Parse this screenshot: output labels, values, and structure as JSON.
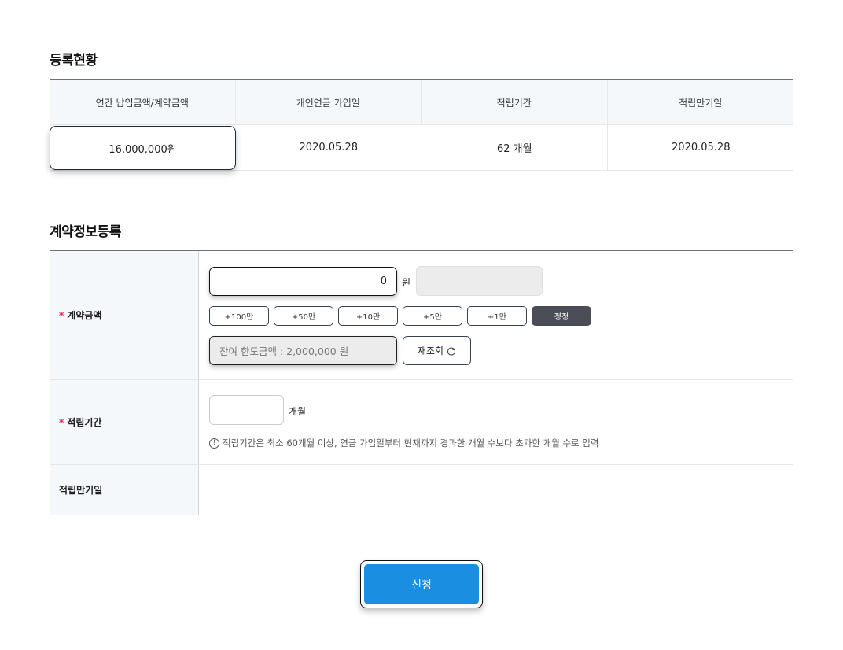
{
  "status": {
    "title": "등록현황",
    "headers": [
      "연간 납입금액/계약금액",
      "개인연금 가입일",
      "적립기간",
      "적립만기일"
    ],
    "values": [
      "16,000,000원",
      "2020.05.28",
      "62 개월",
      "2020.05.28"
    ]
  },
  "contract": {
    "title": "계약정보등록",
    "required_mark": "*",
    "amount_label": "계약금액",
    "amount_value": "0",
    "amount_unit": "원",
    "chips": [
      "+100만",
      "+50만",
      "+10만",
      "+5만",
      "+1만"
    ],
    "correct_label": "정정",
    "limit_text": "잔여 한도금액 : 2,000,000 원",
    "refresh_label": "재조회",
    "period_label": "적립기간",
    "period_value": "",
    "period_unit": "개월",
    "info_glyph": "!",
    "period_note": "적립기간은 최소 60개월 이상, 연금 가입일부터 현재까지 경과한 개월 수보다 초과한 개월 수로 입력",
    "maturity_label": "적립만기일"
  },
  "submit_label": "신청",
  "colors": {
    "accent": "#1a8ee0",
    "required": "#e11d48",
    "header_bg": "#f4f8fb",
    "dark_chip": "#4b4e57"
  }
}
